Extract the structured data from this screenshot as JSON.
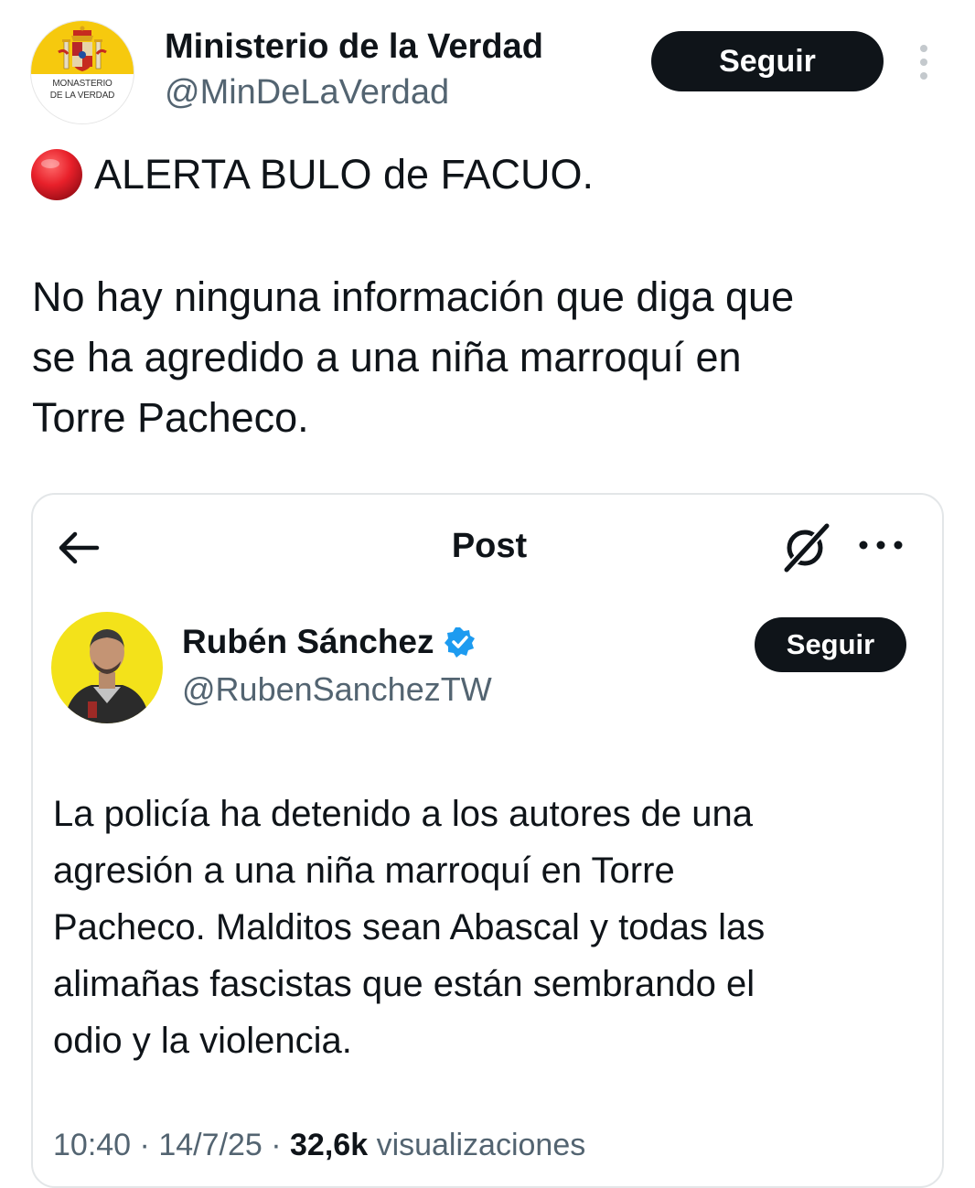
{
  "tweet": {
    "author": {
      "name": "Ministerio de la Verdad",
      "handle": "@MinDeLaVerdad",
      "avatar_text_line1": "MONASTERIO",
      "avatar_text_line2": "DE LA VERDAD"
    },
    "follow_label": "Seguir",
    "menu_icon": "vertical-dots-icon",
    "alert_icon": "red-circle-emoji",
    "alert_text": "ALERTA BULO de FACUO.",
    "body_lines": [
      "No hay ninguna información que diga que",
      "se ha agredido a una niña marroquí en",
      "Torre Pacheco."
    ]
  },
  "embedded_post": {
    "header": {
      "back_icon": "arrow-left-icon",
      "title": "Post",
      "grok_icon": "grok-icon",
      "more_icon": "horizontal-dots-icon"
    },
    "author": {
      "name": "Rubén Sánchez",
      "handle": "@RubenSanchezTW",
      "verified_icon": "verified-badge-icon"
    },
    "follow_label": "Seguir",
    "body_lines": [
      "La policía ha detenido a los autores de una",
      "agresión a una niña marroquí en Torre",
      "Pacheco. Malditos sean Abascal y todas las",
      "alimañas fascistas que están sembrando el",
      "odio y la violencia."
    ],
    "meta": {
      "time": "10:40",
      "separator1": "·",
      "date": "14/7/25",
      "separator2": "·",
      "views": "32,6k",
      "views_label": "visualizaciones"
    }
  },
  "colors": {
    "text_primary": "#0f1419",
    "text_secondary": "#536471",
    "button_bg": "#0f1419",
    "verified_blue": "#1d9bf0",
    "avatar_yellow": "#f6c90e",
    "alert_red": "#e8202a"
  }
}
